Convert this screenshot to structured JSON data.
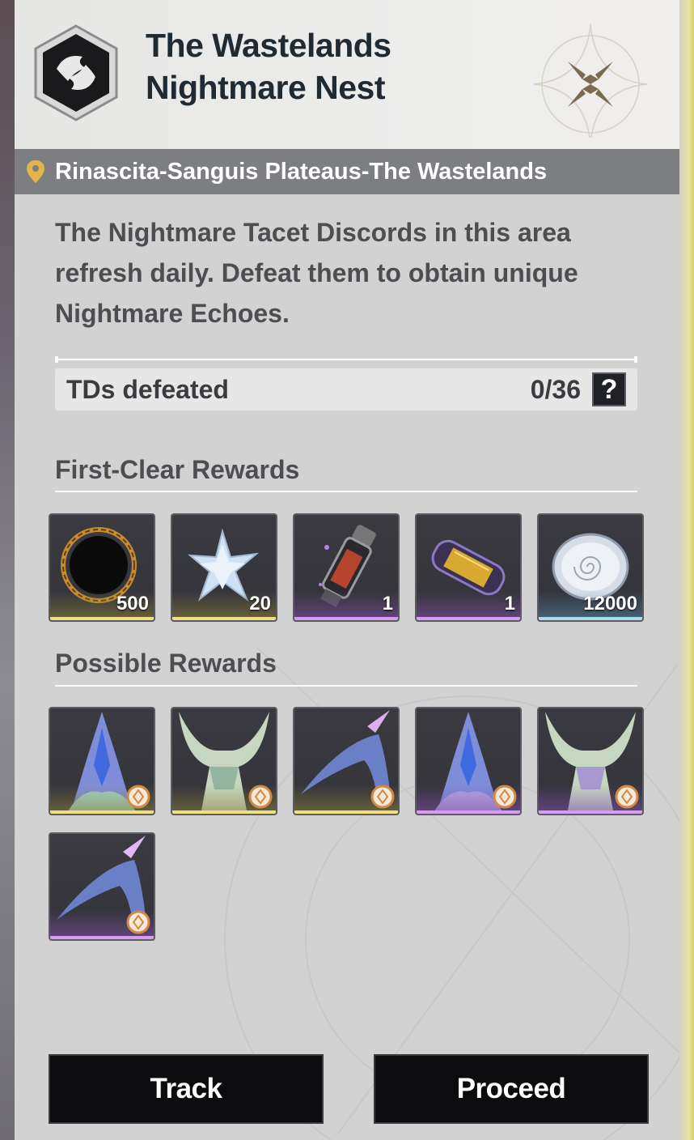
{
  "header": {
    "title_line1": "The Wastelands",
    "title_line2": "Nightmare Nest"
  },
  "location": {
    "icon": "map-pin-icon",
    "text": "Rinascita-Sanguis Plateaus-The Wastelands"
  },
  "description": "The Nightmare Tacet Discords in this area refresh daily. Defeat them to obtain unique Nightmare Echoes.",
  "progress": {
    "label": "TDs defeated",
    "count": "0/36",
    "help_label": "?"
  },
  "first_clear": {
    "title": "First-Clear Rewards",
    "items": [
      {
        "icon": "dark-ring-icon",
        "qty": "500",
        "rarity": "gold"
      },
      {
        "icon": "crystal-star-icon",
        "qty": "20",
        "rarity": "gold"
      },
      {
        "icon": "syringe-vial-icon",
        "qty": "1",
        "rarity": "purple"
      },
      {
        "icon": "capsule-icon",
        "qty": "1",
        "rarity": "purple"
      },
      {
        "icon": "shell-coin-icon",
        "qty": "12000",
        "rarity": "blue"
      }
    ]
  },
  "possible": {
    "title": "Possible Rewards",
    "items": [
      {
        "icon": "echo-crested-icon",
        "rarity": "gold"
      },
      {
        "icon": "echo-horned-icon",
        "rarity": "gold"
      },
      {
        "icon": "echo-beak-icon",
        "rarity": "gold"
      },
      {
        "icon": "echo-crested-icon",
        "rarity": "purple"
      },
      {
        "icon": "echo-horned-icon",
        "rarity": "purple"
      },
      {
        "icon": "echo-beak-icon",
        "rarity": "purple"
      }
    ]
  },
  "buttons": {
    "track": "Track",
    "proceed": "Proceed"
  },
  "colors": {
    "title": "#1f2a33",
    "gold": "#f0de84",
    "purple": "#d59cf2",
    "blue": "#a9dcee",
    "button_bg": "#0c0c0e"
  }
}
